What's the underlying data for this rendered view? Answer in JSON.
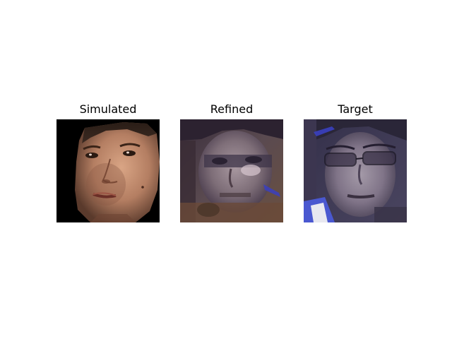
{
  "figure": {
    "panels": [
      {
        "title": "Simulated",
        "description_icon": "face-photo-simulated",
        "background": "#000000",
        "skin": "#c08a6e"
      },
      {
        "title": "Refined",
        "description_icon": "face-photo-refined",
        "background": "#4a3f4f",
        "skin": "#8a7a80"
      },
      {
        "title": "Target",
        "description_icon": "face-photo-target",
        "background": "#3d3a50",
        "skin": "#8c8090"
      }
    ]
  }
}
